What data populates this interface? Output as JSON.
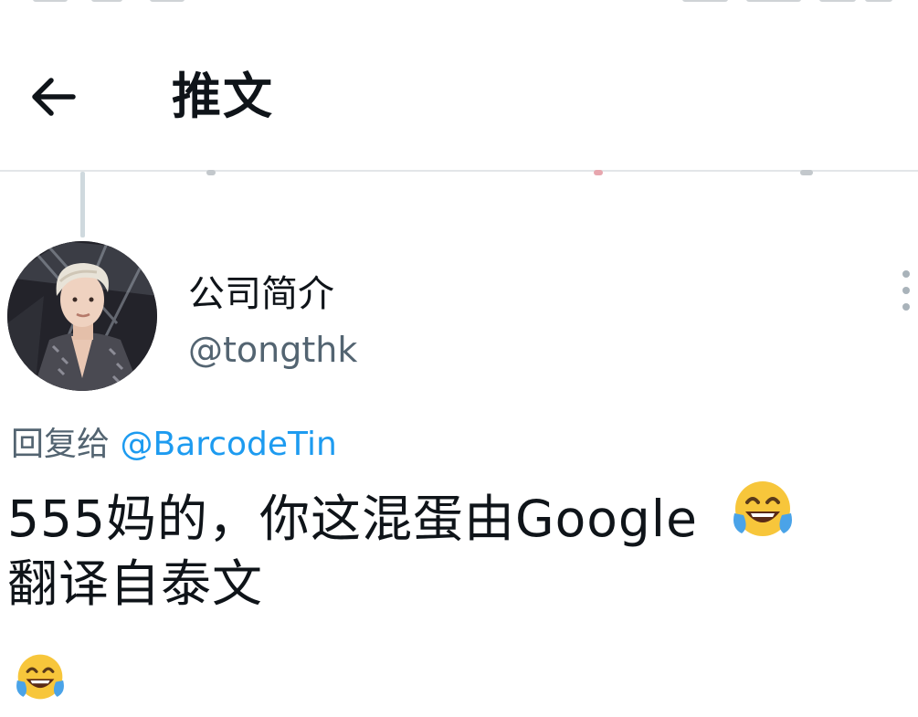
{
  "header": {
    "back_icon": "arrow-left-icon",
    "title": "推文"
  },
  "tweet": {
    "avatar_icon": "user-avatar-photo",
    "display_name": "公司简介",
    "handle": "@tongthk",
    "more_icon": "more-vertical-icon",
    "reply_prefix": "回复给",
    "reply_mention": "@BarcodeTin",
    "text_line1": "555妈的，你这混蛋由Google",
    "text_line2": "翻译自泰文",
    "emoji": "tears-of-joy-emoji"
  },
  "colors": {
    "text": "#0f1419",
    "secondary": "#536471",
    "link": "#1d9bf0",
    "divider": "#e3e6e8",
    "thread_line": "#cfd9de"
  }
}
